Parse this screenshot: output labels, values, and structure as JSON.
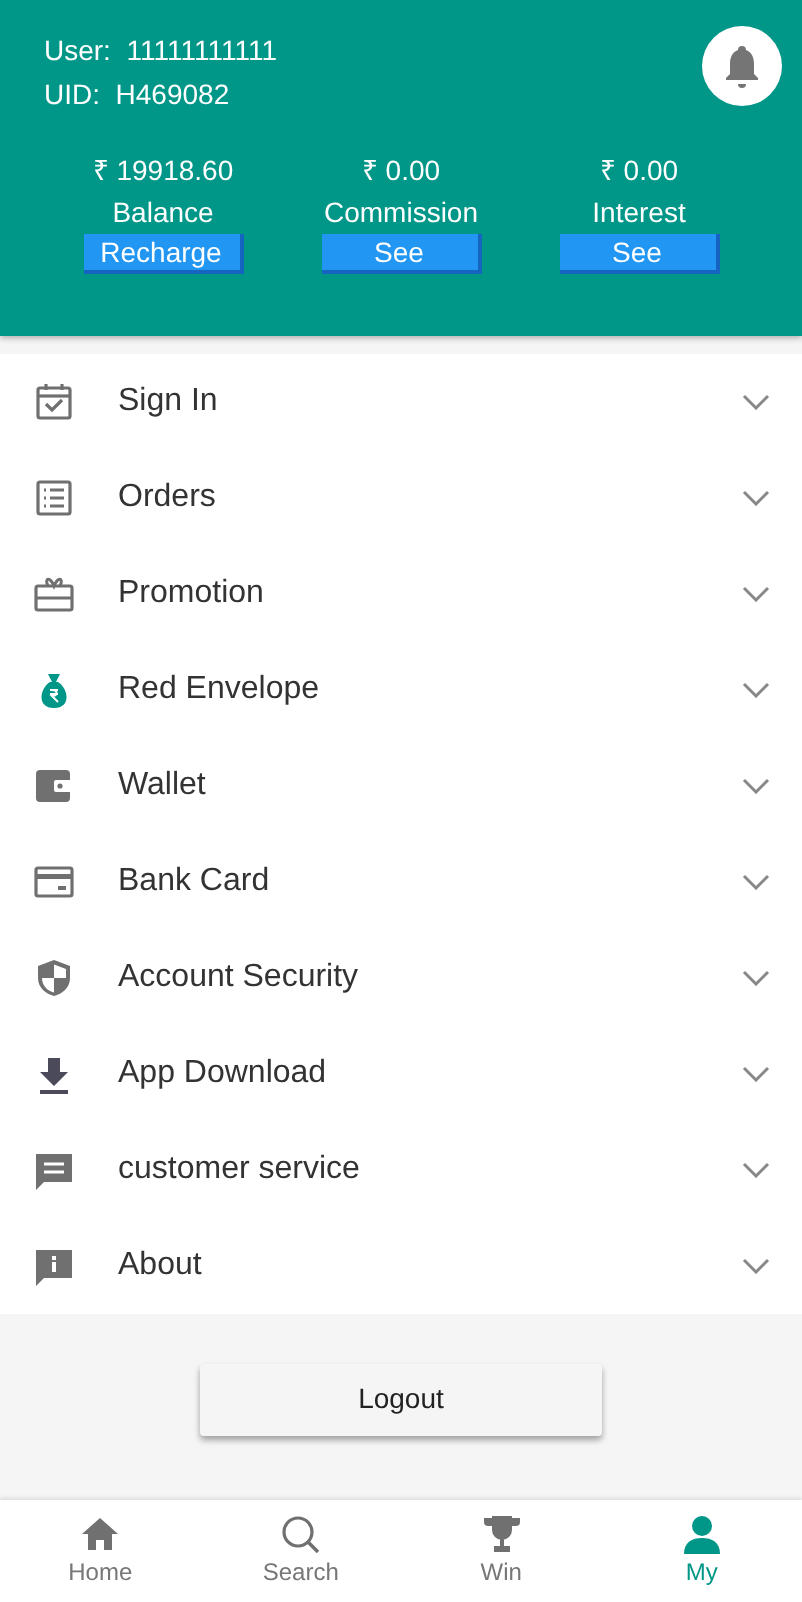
{
  "account": {
    "user_label": "User:",
    "user": "11111111111",
    "uid_label": "UID:",
    "uid": "H469082"
  },
  "stats": [
    {
      "amount": "₹ 19918.60",
      "label": "Balance",
      "button": "Recharge"
    },
    {
      "amount": "₹ 0.00",
      "label": "Commission",
      "button": "See"
    },
    {
      "amount": "₹ 0.00",
      "label": "Interest",
      "button": "See"
    }
  ],
  "menu": [
    {
      "label": "Sign In"
    },
    {
      "label": "Orders"
    },
    {
      "label": "Promotion"
    },
    {
      "label": "Red Envelope"
    },
    {
      "label": "Wallet"
    },
    {
      "label": "Bank Card"
    },
    {
      "label": "Account Security"
    },
    {
      "label": "App Download"
    },
    {
      "label": "customer service"
    },
    {
      "label": "About"
    }
  ],
  "logout": "Logout",
  "nav": [
    {
      "label": "Home",
      "selected": false
    },
    {
      "label": "Search",
      "selected": false
    },
    {
      "label": "Win",
      "selected": false
    },
    {
      "label": "My",
      "selected": true
    }
  ]
}
